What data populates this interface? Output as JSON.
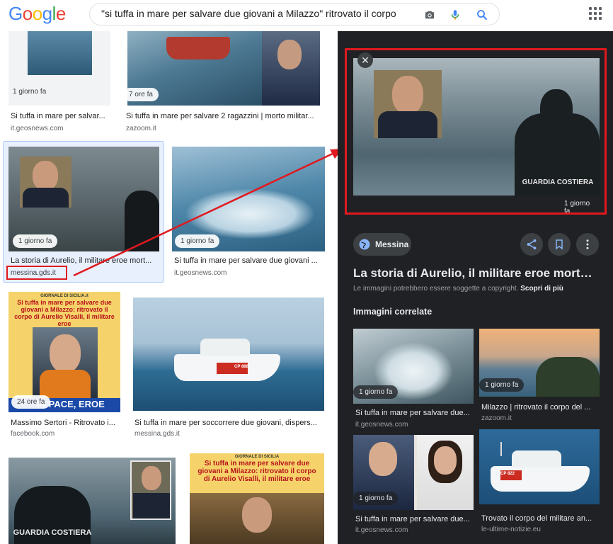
{
  "logo": {
    "letters": [
      "G",
      "o",
      "o",
      "g",
      "l",
      "e"
    ],
    "colors": [
      "#4285f4",
      "#ea4335",
      "#fbbc05",
      "#4285f4",
      "#34a853",
      "#ea4335"
    ]
  },
  "search": {
    "value": "\"si tuffa in mare per salvare due giovani a Milazzo\" ritrovato il corpo",
    "icons": [
      "camera-icon",
      "mic-icon",
      "search-icon"
    ]
  },
  "results": [
    {
      "badge": "1 giorno fa",
      "title": "Si tuffa in mare per salvar...",
      "source": "it.geosnews.com"
    },
    {
      "badge": "7 ore fa",
      "title": "Si tuffa in mare per salvare 2 ragazzini | morto militar...",
      "source": "zazoom.it"
    },
    {
      "badge": "1 giorno fa",
      "title": "La storia di Aurelio, il militare eroe mort...",
      "source": "messina.gds.it"
    },
    {
      "badge": "1 giorno fa",
      "title": "Si tuffa in mare per salvare due giovani ...",
      "source": "it.geosnews.com"
    },
    {
      "badge": "24 ore fa",
      "title": "Massimo Sertori - Ritrovato i...",
      "source": "facebook.com"
    },
    {
      "badge": "",
      "title": "Si tuffa in mare per soccorrere due giovani, dispers...",
      "source": "messina.gds.it"
    }
  ],
  "news_card": {
    "kicker": "GIORNALE DI SICILIA.it",
    "headline": "Si tuffa in mare per salvare due giovani a Milazzo: ritrovato il corpo di Aurelio Visalli, il militare eroe",
    "banner": "RIPOSA IN PACE, EROE",
    "banner_visible": "IN PACE, EROE"
  },
  "news_card_2": {
    "kicker": "GIORNALE DI SICILIA",
    "headline": "Si tuffa in mare per salvare due giovani a Milazzo: ritrovato il corpo di Aurelio Visalli, il militare eroe"
  },
  "photo_text": {
    "guardia": "GUARDIA COSTIERA",
    "guardia_short": "GUARDIA",
    "boat_code": "CP 888",
    "boat_code_2": "CP 822"
  },
  "panel": {
    "preview_badge": "1 giorno fa",
    "site_chip": "Messina",
    "title": "La storia di Aurelio, il militare eroe morto ...",
    "copyright_note": "Le immagini potrebbero essere soggette a copyright.",
    "learn_more": "Scopri di più",
    "related_heading": "Immagini correlate",
    "related": [
      {
        "badge": "1 giorno fa",
        "title": "Si tuffa in mare per salvare due...",
        "source": "it.geosnews.com"
      },
      {
        "badge": "1 giorno fa",
        "title": "Milazzo | ritrovato il corpo del ...",
        "source": "zazoom.it"
      },
      {
        "badge": "1 giorno fa",
        "title": "Si tuffa in mare per salvare due...",
        "source": "it.geosnews.com"
      },
      {
        "badge": "",
        "title": "Trovato il corpo del militare an...",
        "source": "le-ultime-notizie.eu"
      }
    ]
  },
  "colors": {
    "highlight": "#e0191f",
    "panel_bg": "#202124",
    "accent": "#1a73e8"
  }
}
